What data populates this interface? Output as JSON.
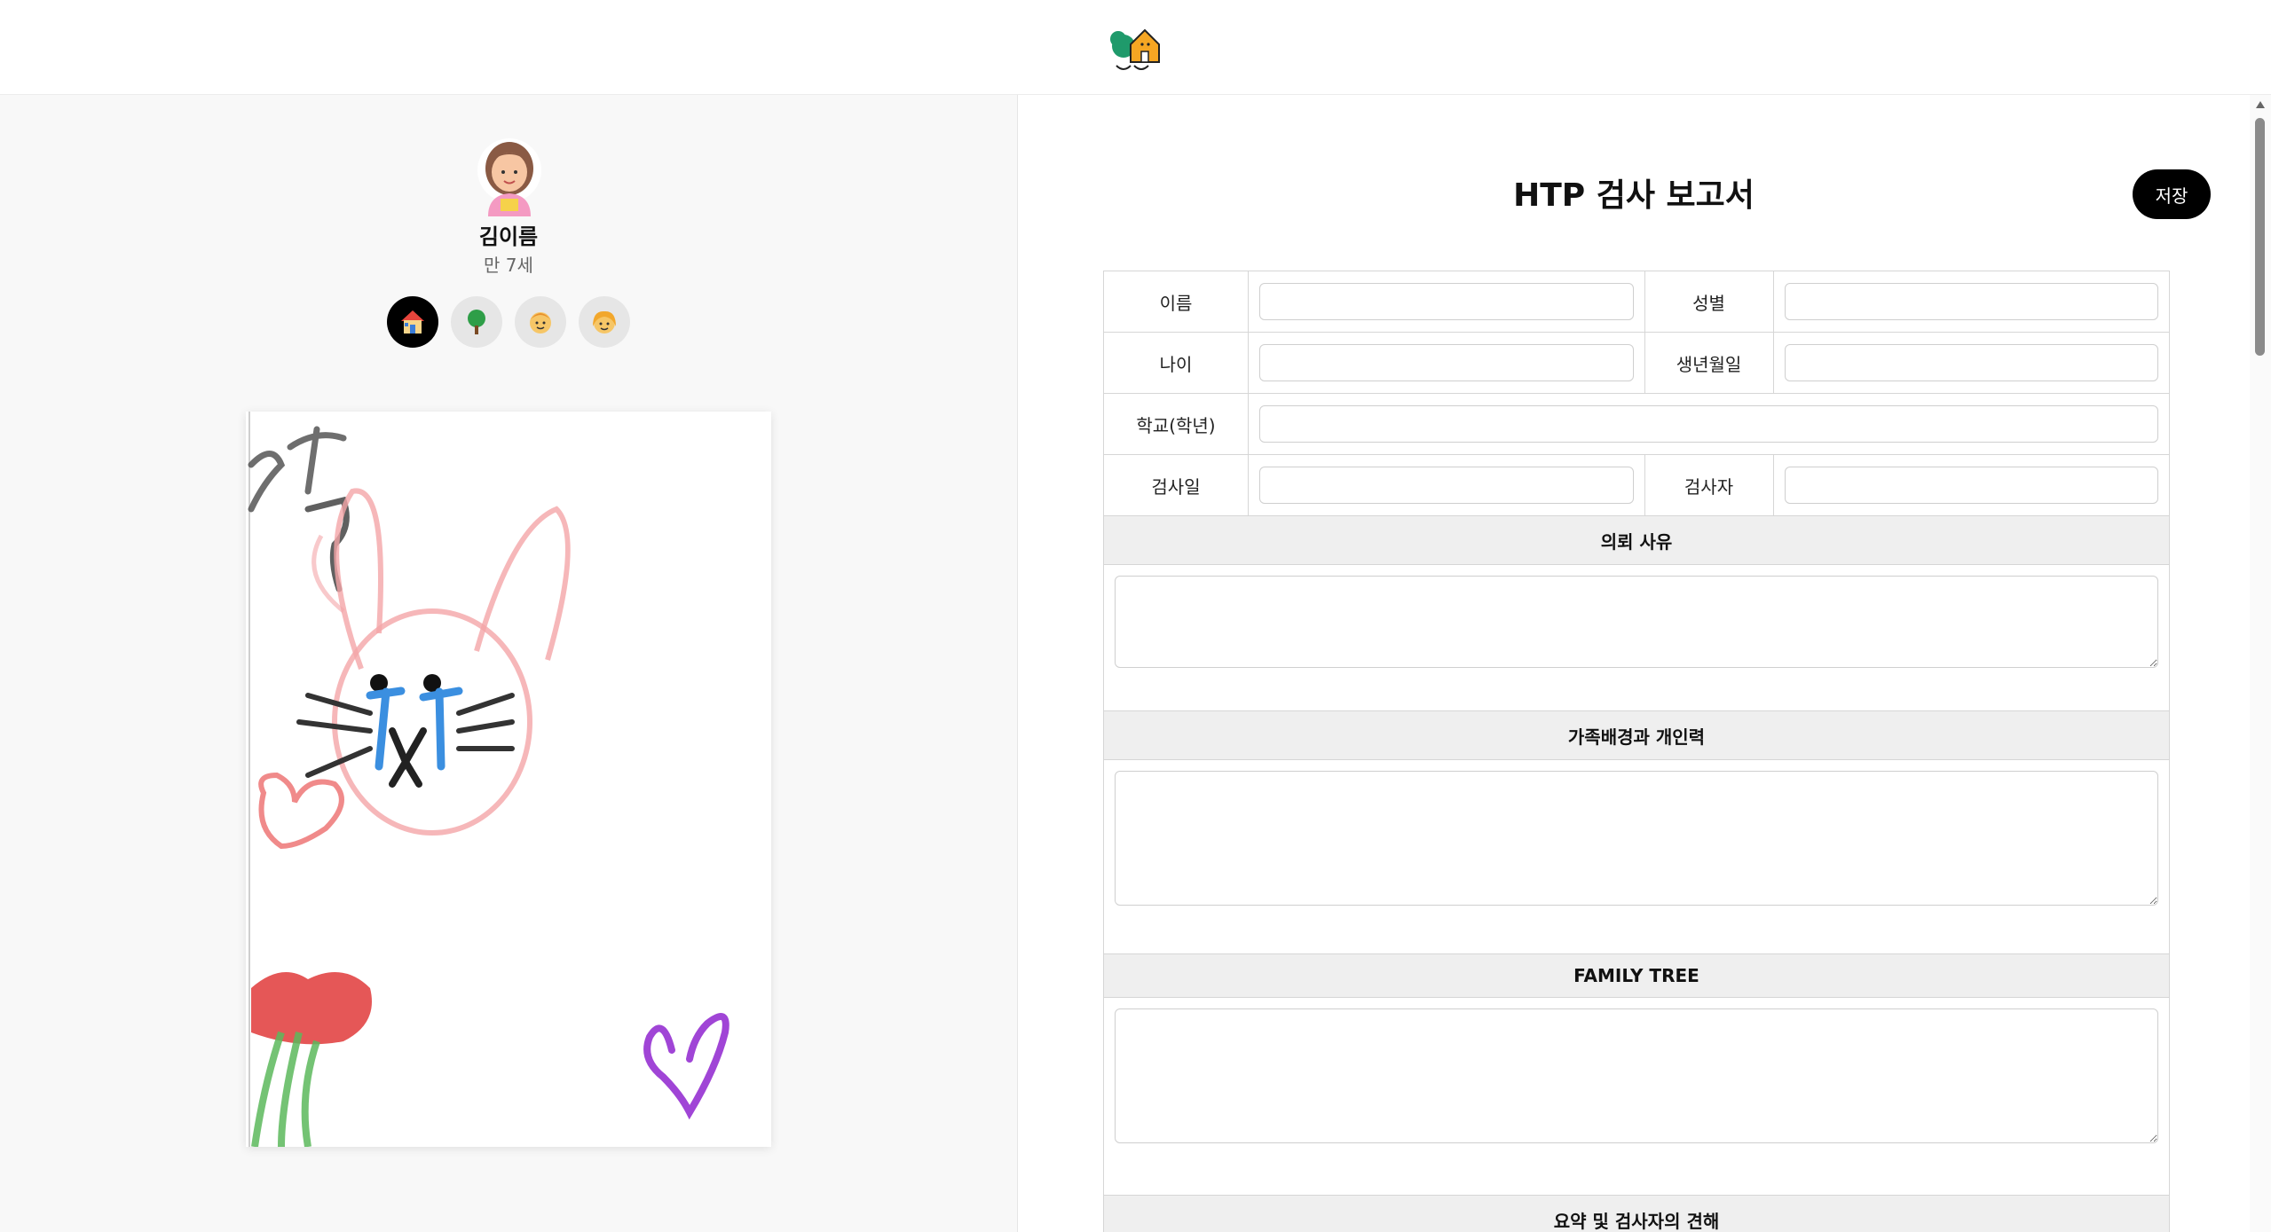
{
  "app": {
    "logo_icon": "house-tree-logo-icon"
  },
  "profile": {
    "name": "김이름",
    "age": "만 7세",
    "avatar_icon": "girl-avatar-icon"
  },
  "drawing_tabs": [
    {
      "icon": "house-icon",
      "active": true
    },
    {
      "icon": "tree-icon",
      "active": false
    },
    {
      "icon": "boy-icon",
      "active": false
    },
    {
      "icon": "girl-icon",
      "active": false
    }
  ],
  "drawing": {
    "description_icon": "child-drawing-canvas"
  },
  "report": {
    "title": "HTP 검사 보고서",
    "save_label": "저장",
    "fields": {
      "name_label": "이름",
      "gender_label": "성별",
      "age_label": "나이",
      "birth_label": "생년월일",
      "school_label": "학교(학년)",
      "test_date_label": "검사일",
      "examiner_label": "검사자"
    },
    "values": {
      "name": "",
      "gender": "",
      "age": "",
      "birth": "",
      "school": "",
      "test_date": "",
      "examiner": ""
    },
    "sections": {
      "referral_title": "의뢰 사유",
      "family_title": "가족배경과 개인력",
      "family_tree_title": "FAMILY TREE",
      "summary_title": "요약 및 검사자의 견해"
    }
  },
  "colors": {
    "accent": "#000000",
    "panel_bg": "#f8f8f8",
    "section_bg": "#efefef"
  }
}
